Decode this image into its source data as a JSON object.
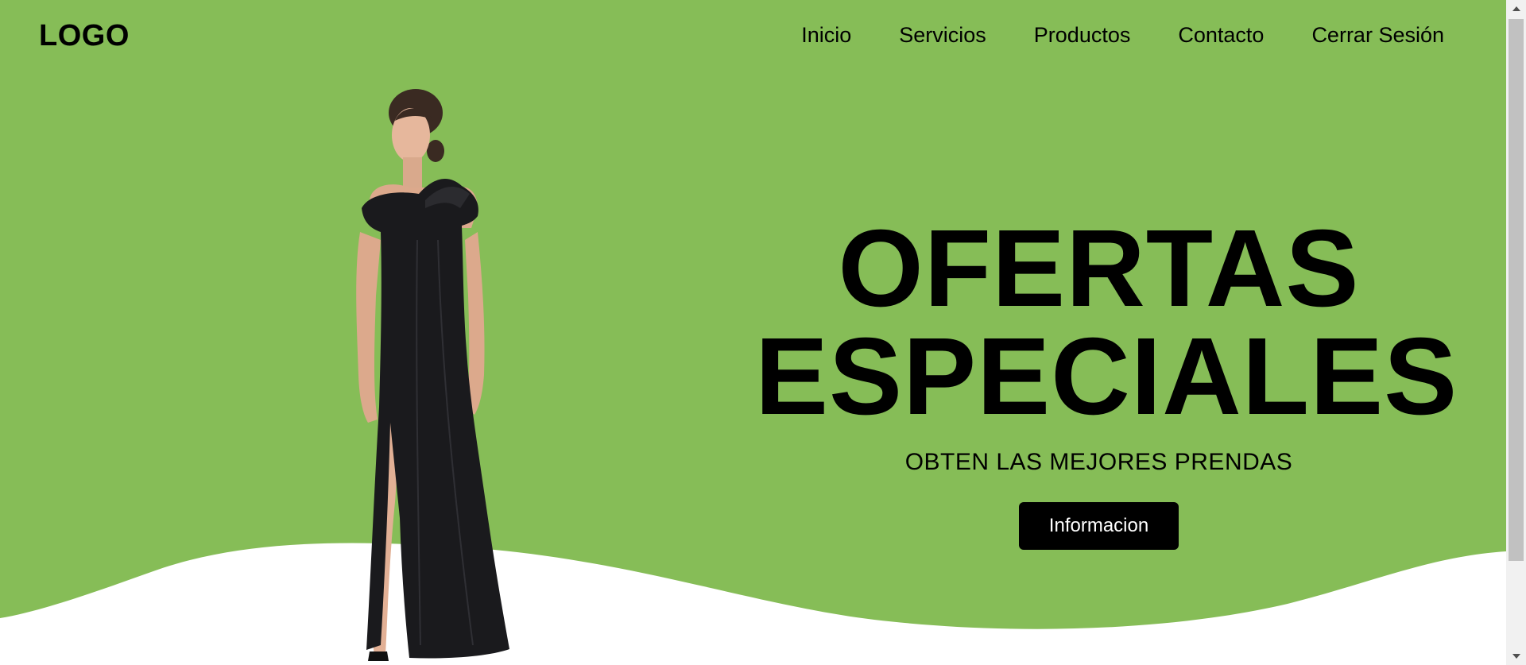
{
  "header": {
    "logo": "LOGO",
    "nav": [
      "Inicio",
      "Servicios",
      "Productos",
      "Contacto",
      "Cerrar Sesión"
    ]
  },
  "hero": {
    "title_line1": "OFERTAS",
    "title_line2": "ESPECIALES",
    "subtitle": "OBTEN LAS MEJORES PRENDAS",
    "button_label": "Informacion",
    "image": "model-in-black-evening-gown"
  },
  "colors": {
    "hero_green": "#86bd57",
    "wave_white": "#ffffff",
    "button_bg": "#000000",
    "text": "#000000"
  }
}
